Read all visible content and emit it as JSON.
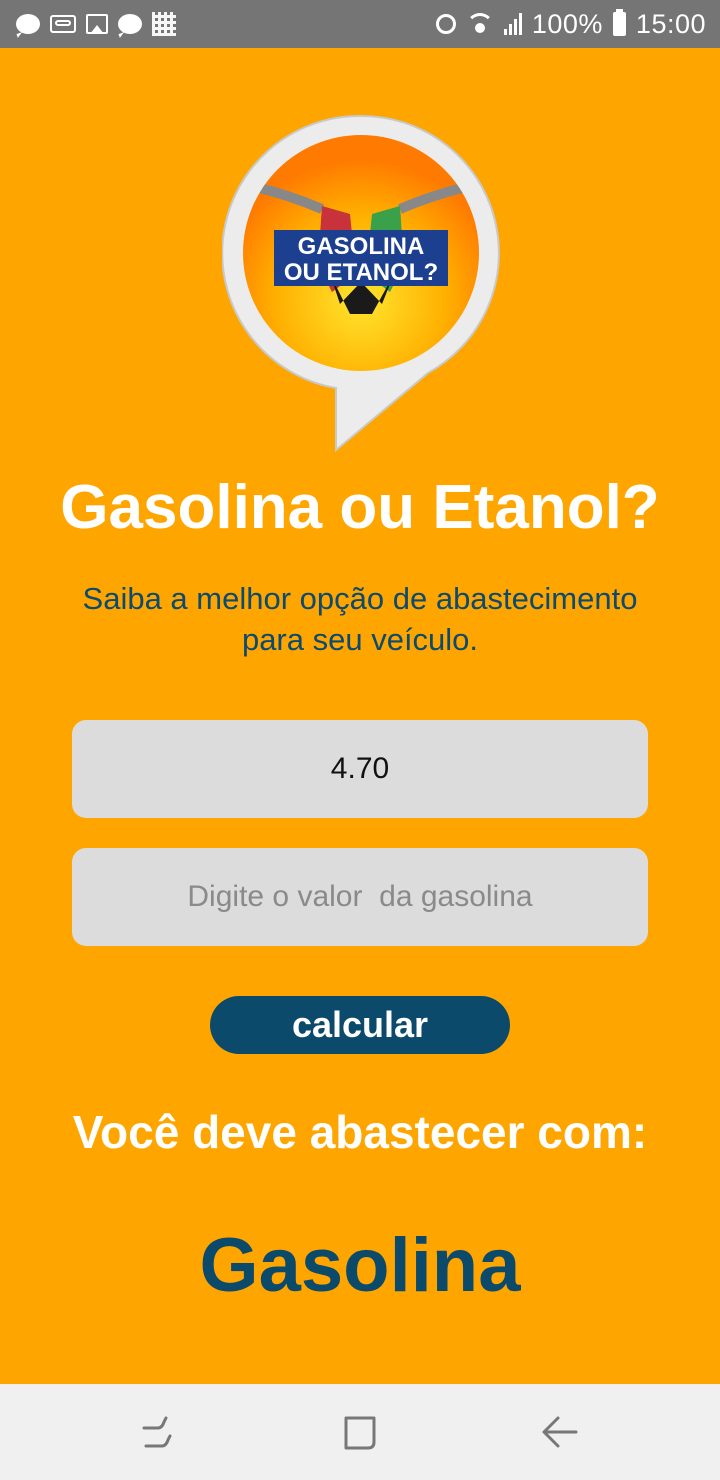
{
  "status_bar": {
    "battery": "100%",
    "time": "15:00",
    "left_icons": [
      "chat-bubble-icon",
      "voicemail-icon",
      "image-icon",
      "chat-bubble-icon",
      "grid-icon"
    ],
    "right_icons": [
      "alarm-icon",
      "wifi-icon",
      "signal-icon",
      "battery-icon"
    ]
  },
  "logo": {
    "line1": "GASOLINA",
    "line2": "OU ETANOL?"
  },
  "app": {
    "title": "Gasolina ou Etanol?",
    "subtitle_line1": "Saiba a melhor opção de abastecimento",
    "subtitle_line2": "para seu veículo."
  },
  "form": {
    "ethanol_value": "4.70",
    "gasoline_placeholder": "Digite o valor  da gasolina",
    "gasoline_value": ""
  },
  "button": {
    "calculate_label": "calcular"
  },
  "result": {
    "label": "Você deve abastecer com:",
    "value": "Gasolina"
  },
  "colors": {
    "background": "#ffa500",
    "accent": "#0b4a6b",
    "field": "#dcdcdc",
    "title": "#ffffff"
  },
  "nav_bar": {
    "icons": [
      "recent-apps-icon",
      "home-icon",
      "back-icon"
    ]
  }
}
